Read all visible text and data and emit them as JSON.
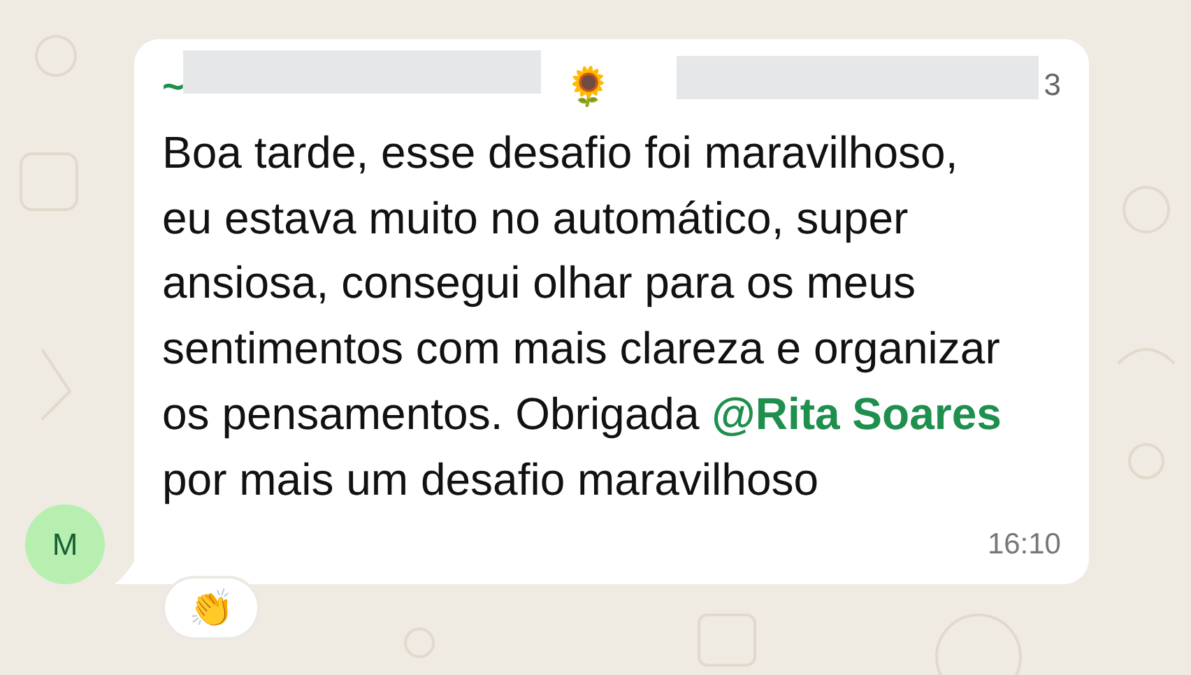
{
  "message": {
    "sender": "~",
    "sender_emoji": "🌻",
    "phone_tail": "3",
    "text_before": "Boa tarde, esse desafio foi maravilhoso, eu estava muito no automático, super ansiosa, consegui olhar para os meus sentimentos com mais clareza e organizar os pensamentos. Obrigada ",
    "mention": "@Rita Soares",
    "text_after": " por mais um desafio maravilhoso",
    "time": "16:10",
    "avatar_initial": "M",
    "reactions": [
      "👏"
    ]
  }
}
